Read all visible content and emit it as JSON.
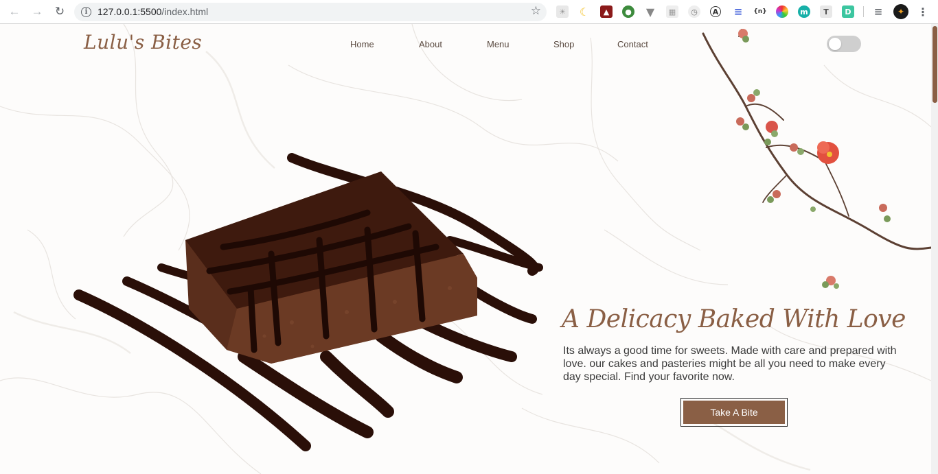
{
  "browser": {
    "url_host": "127.0.0.1:5500",
    "url_path": "/index.html",
    "extensions": [
      "moon-extension",
      "acrobat-extension",
      "globe-extension",
      "vuejs-extension",
      "grid-extension",
      "clock-extension",
      "a-extension",
      "lines-extension",
      "json-extension",
      "color-wheel-extension",
      "m-extension",
      "t-extension",
      "d-extension",
      "reading-list-icon",
      "avatar-extension",
      "menu-dots-icon"
    ],
    "ext_json": "{n}",
    "ext_m": "m",
    "ext_t": "T",
    "ext_d": "D",
    "ext_a": "A"
  },
  "site": {
    "logo": "Lulu's Bites",
    "nav": [
      "Home",
      "About",
      "Menu",
      "Shop",
      "Contact"
    ],
    "theme_toggle": "off"
  },
  "hero": {
    "headline": "A Delicacy Baked With Love",
    "tagline": "Its always a good time for sweets. Made with care and prepared with love. our cakes and pasteries might be all you need to make every day special. Find your favorite now.",
    "cta": "Take A Bite"
  },
  "colors": {
    "brand": "#8a5f45",
    "background": "#fdfcfb",
    "chocolate": "#3b1a10"
  }
}
